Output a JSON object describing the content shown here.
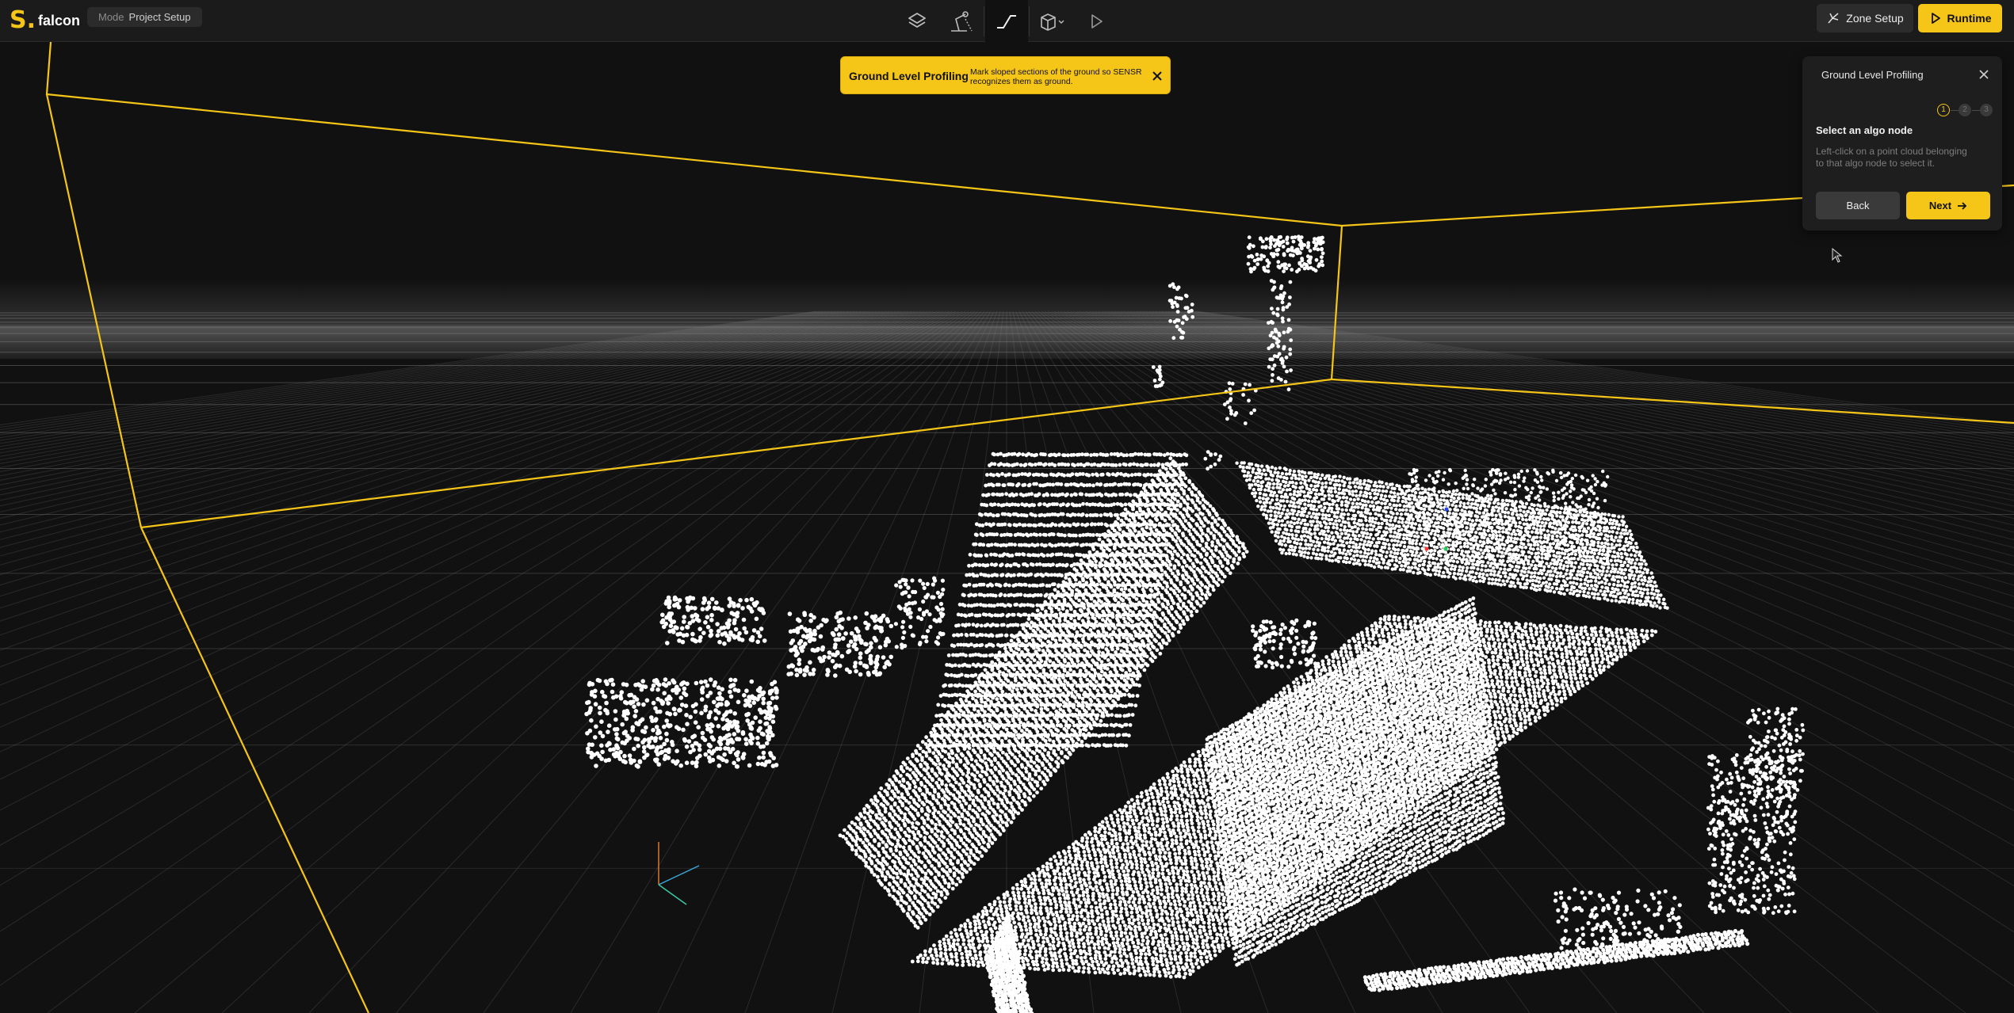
{
  "app": {
    "name": "falcon",
    "logo": "S."
  },
  "mode": {
    "label": "Mode",
    "value": "Project Setup"
  },
  "toolbar": {
    "tools": [
      {
        "icon": "layers-icon"
      },
      {
        "icon": "sensor-icon"
      },
      {
        "icon": "ground-slope-icon",
        "active": true
      },
      {
        "icon": "cube-icon"
      },
      {
        "icon": "play-icon"
      }
    ]
  },
  "actions": {
    "zone_setup": "Zone Setup",
    "runtime": "Runtime"
  },
  "banner": {
    "title": "Ground Level Profiling",
    "text": "Mark sloped sections of the ground so SENSR recognizes them as ground."
  },
  "panel": {
    "title": "Ground Level Profiling",
    "steps": [
      "1",
      "2",
      "3"
    ],
    "current_step": 1,
    "heading": "Select an algo node",
    "description": "Left-click on a point cloud belonging to that algo node to select it.",
    "back": "Back",
    "next": "Next"
  },
  "colors": {
    "accent": "#f5c518",
    "background": "#111111",
    "topbar": "#1b1b1b"
  }
}
